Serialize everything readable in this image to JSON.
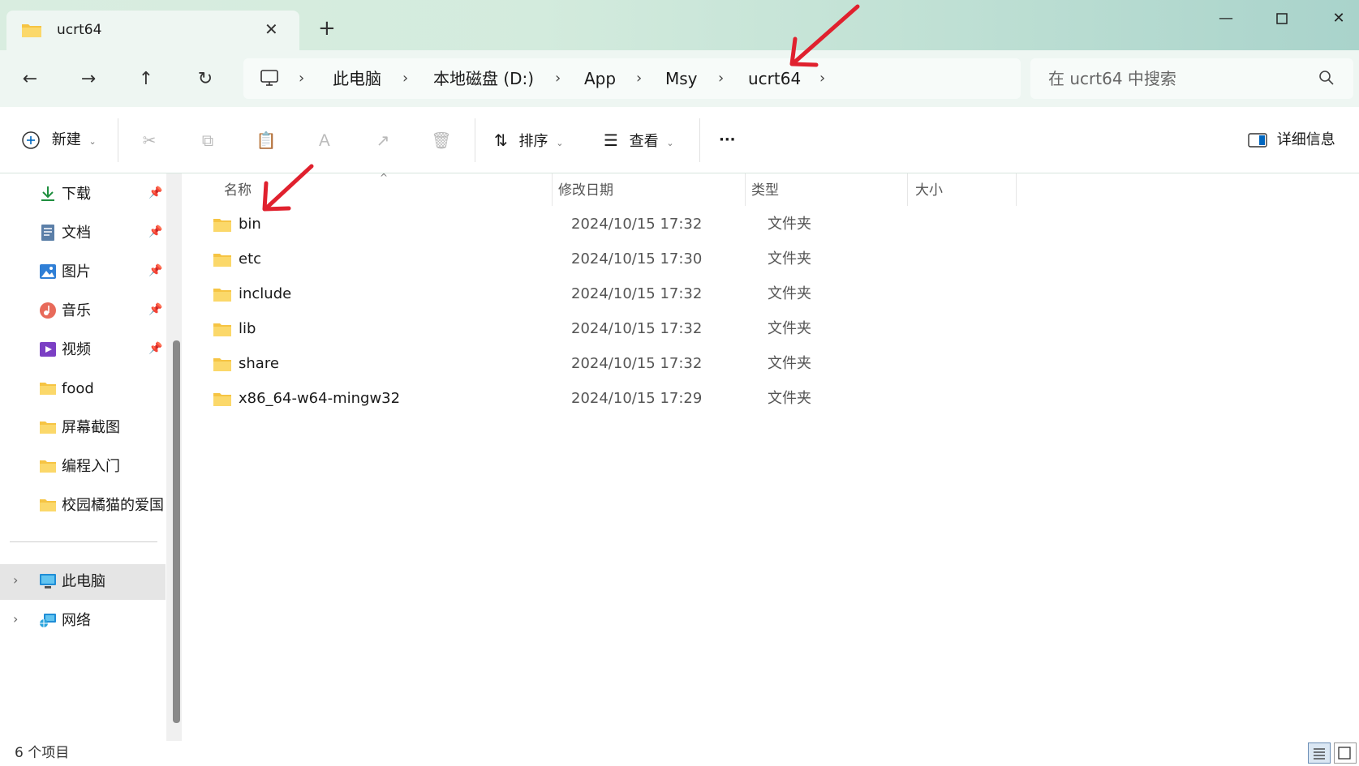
{
  "window": {
    "tab_title": "ucrt64",
    "new_tab_label": "+",
    "controls": {
      "minimize": "—",
      "maximize": "☐",
      "close": "✕"
    }
  },
  "nav": {
    "back_icon": "←",
    "forward_icon": "→",
    "up_icon": "↑",
    "refresh_icon": "↻",
    "breadcrumb": [
      "此电脑",
      "本地磁盘 (D:)",
      "App",
      "Msy",
      "ucrt64"
    ],
    "separator": "›",
    "search_placeholder": "在 ucrt64 中搜索"
  },
  "toolbar": {
    "new_label": "新建",
    "sort_label": "排序",
    "view_label": "查看",
    "more_label": "···",
    "details_label": "详细信息"
  },
  "sidebar": {
    "quick_access": [
      {
        "label": "下载",
        "icon": "download-icon",
        "pinned": true
      },
      {
        "label": "文档",
        "icon": "document-icon",
        "pinned": true
      },
      {
        "label": "图片",
        "icon": "picture-icon",
        "pinned": true
      },
      {
        "label": "音乐",
        "icon": "music-icon",
        "pinned": true
      },
      {
        "label": "视频",
        "icon": "video-icon",
        "pinned": true
      },
      {
        "label": "food",
        "icon": "folder-icon",
        "pinned": false
      },
      {
        "label": "屏幕截图",
        "icon": "folder-icon",
        "pinned": false
      },
      {
        "label": "编程入门",
        "icon": "folder-icon",
        "pinned": false
      },
      {
        "label": "校园橘猫的爱国",
        "icon": "folder-icon",
        "pinned": false
      }
    ],
    "this_pc": "此电脑",
    "network": "网络"
  },
  "file_list": {
    "columns": {
      "name": "名称",
      "date": "修改日期",
      "type": "类型",
      "size": "大小"
    },
    "rows": [
      {
        "name": "bin",
        "date": "2024/10/15 17:32",
        "type": "文件夹",
        "size": ""
      },
      {
        "name": "etc",
        "date": "2024/10/15 17:30",
        "type": "文件夹",
        "size": ""
      },
      {
        "name": "include",
        "date": "2024/10/15 17:32",
        "type": "文件夹",
        "size": ""
      },
      {
        "name": "lib",
        "date": "2024/10/15 17:32",
        "type": "文件夹",
        "size": ""
      },
      {
        "name": "share",
        "date": "2024/10/15 17:32",
        "type": "文件夹",
        "size": ""
      },
      {
        "name": "x86_64-w64-mingw32",
        "date": "2024/10/15 17:29",
        "type": "文件夹",
        "size": ""
      }
    ]
  },
  "status": {
    "item_count": "6 个项目"
  },
  "colors": {
    "accent": "#0067c0",
    "folder": "#f6c443",
    "annotation": "#e0212e"
  }
}
